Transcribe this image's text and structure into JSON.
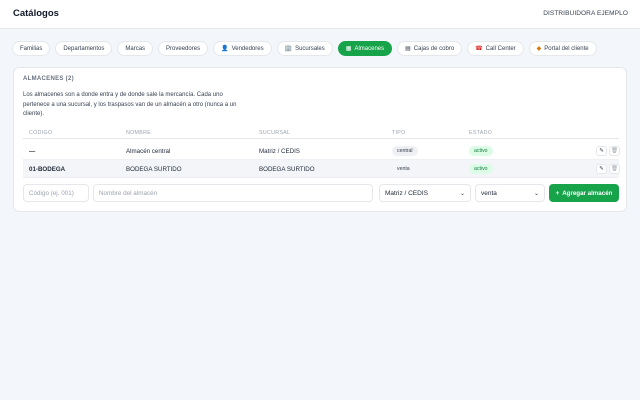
{
  "header": {
    "title": "Catálogos",
    "company": "DISTRIBUIDORA EJEMPLO"
  },
  "tabs": [
    {
      "label": "Familias",
      "icon": "",
      "active": false
    },
    {
      "label": "Departamentos",
      "icon": "",
      "active": false
    },
    {
      "label": "Marcas",
      "icon": "",
      "active": false
    },
    {
      "label": "Proveedores",
      "icon": "",
      "active": false
    },
    {
      "label": "Vendedores",
      "icon": "person-icon",
      "active": false
    },
    {
      "label": "Sucursales",
      "icon": "building-icon",
      "active": false
    },
    {
      "label": "Almacenes",
      "icon": "boxes-icon",
      "active": true
    },
    {
      "label": "Cajas de cobro",
      "icon": "register-icon",
      "active": false
    },
    {
      "label": "Call Center",
      "icon": "phone-icon",
      "active": false
    },
    {
      "label": "Portal del cliente",
      "icon": "shop-icon",
      "active": false
    }
  ],
  "section": {
    "title": "ALMACENES (2)",
    "description": "Los almacenes son a donde entra y de donde sale la mercancía. Cada uno pertenece a una sucursal, y los traspasos van de un almacén a otro (nunca a un cliente)."
  },
  "table": {
    "headers": {
      "code": "CÓDIGO",
      "name": "NOMBRE",
      "branch": "SUCURSAL",
      "type": "TIPO",
      "status": "ESTADO"
    },
    "rows": [
      {
        "code": "—",
        "name": "Almacén central",
        "branch": "Matriz / CEDIS",
        "type": "central",
        "status": "activo"
      },
      {
        "code": "01-BODEGA",
        "name": "BODEGA SURTIDO",
        "branch": "BODEGA SURTIDO",
        "type": "venta",
        "status": "activo"
      }
    ]
  },
  "form": {
    "code_placeholder": "Código (ej. 001)",
    "name_placeholder": "Nombre del almacén",
    "branch_selected": "Matriz / CEDIS",
    "type_selected": "venta",
    "add_label": "Agregar almacén"
  },
  "colors": {
    "accent": "#16a34a",
    "active_badge_bg": "#dcfce7",
    "active_badge_text": "#15803d"
  }
}
